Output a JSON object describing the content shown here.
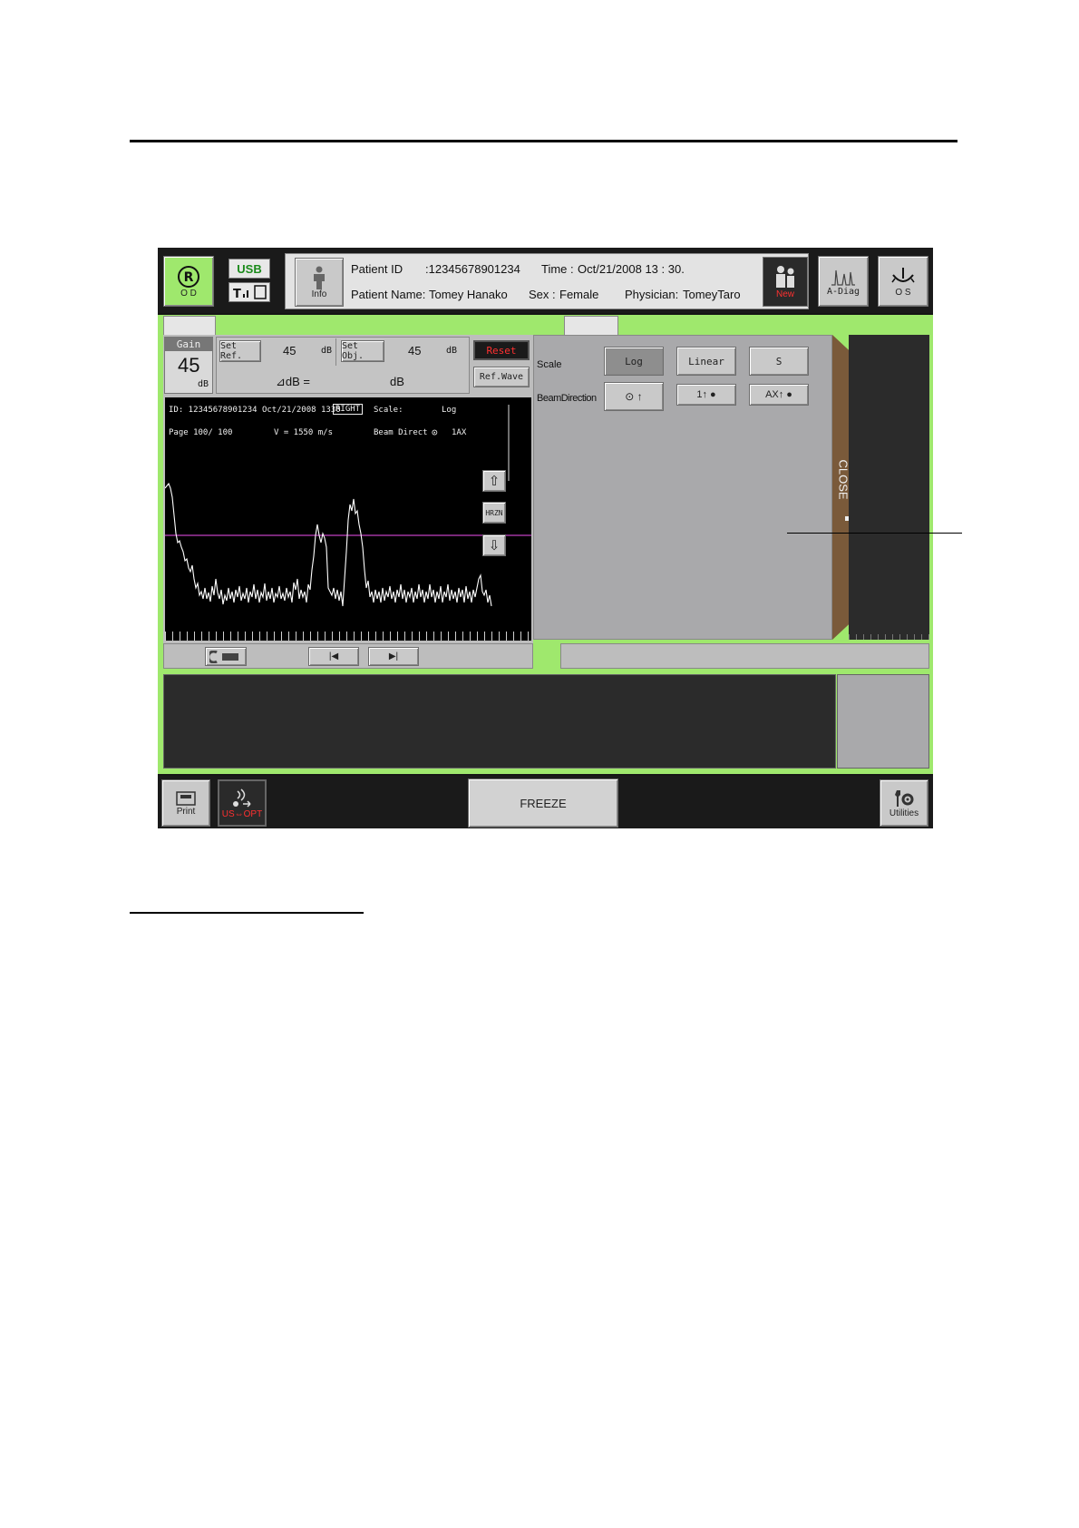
{
  "header_bar": {
    "od_label": "O D",
    "usb_label": "USB",
    "info_label": "Info",
    "patient_id_label": "Patient ID",
    "patient_id_value": ":12345678901234",
    "time_label": "Time :",
    "time_value": "Oct/21/2008   13 : 30.",
    "patient_name_label": "Patient Name:",
    "patient_name_value": "Tomey Hanako",
    "sex_label": "Sex :",
    "sex_value": "Female",
    "physician_label": "Physician:",
    "physician_value": "TomeyTaro",
    "new_label": "New",
    "adiag_label": "A-Diag",
    "os_label": "O S"
  },
  "left_panel": {
    "gain_label": "Gain",
    "gain_value": "45",
    "gain_unit": "dB",
    "set_ref_label": "Set Ref.",
    "set_ref_value": "45",
    "set_ref_unit": "dB",
    "set_obj_label": "Set Obj.",
    "set_obj_value": "45",
    "set_obj_unit": "dB",
    "delta_db_label": "⊿dB  =",
    "delta_db_unit": "dB",
    "reset_label": "Reset",
    "ref_wave_label": "Ref.Wave"
  },
  "waveform": {
    "info_line1_id": "ID: 12345678901234   Oct/21/2008  1330",
    "info_line1_eye": "RIGHT",
    "info_line1_scale_label": "Scale:",
    "info_line1_scale_value": "Log",
    "info_line2_page": "Page  100/  100",
    "info_line2_velocity": "V = 1550  m/s",
    "info_line2_beam": "Beam Direct",
    "info_line2_beam_value": "1AX",
    "hrzn_label": "HRZN"
  },
  "right_panel": {
    "scale_label": "Scale",
    "log_label": "Log",
    "linear_label": "Linear",
    "s_label": "S",
    "beam_direction_label": "BeamDirection",
    "beam_btn1": "⊙  ↑",
    "beam_btn2": "1↑   ●",
    "beam_btn3": "AX↑   ●",
    "close_label": "CLOSE"
  },
  "bottom_bar": {
    "print_label": "Print",
    "us_opt_label": "US⇔OPT",
    "freeze_label": "FREEZE",
    "utilities_label": "Utilities"
  },
  "colors": {
    "frame_green": "#9fe86d",
    "button_gray": "#c9c9c9",
    "panel_gray": "#a9a9ab",
    "waveform_line": "#ffffff",
    "threshold_line": "#c040c0",
    "reset_text": "#ff3030",
    "close_tab_brown": "#7a5a3a"
  }
}
